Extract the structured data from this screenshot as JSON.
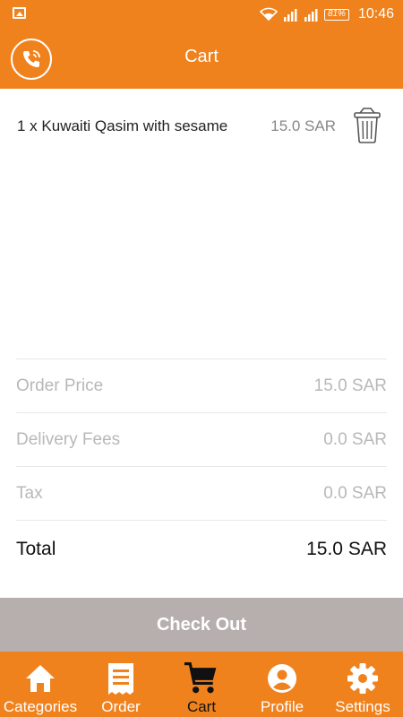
{
  "status_bar": {
    "battery": "81%",
    "time": "10:46"
  },
  "header": {
    "title": "Cart"
  },
  "cart_items": [
    {
      "description": "1 x Kuwaiti Qasim with sesame",
      "price": "15.0 SAR"
    }
  ],
  "summary": {
    "order_price_label": "Order Price",
    "order_price": "15.0 SAR",
    "delivery_label": "Delivery Fees",
    "delivery": "0.0 SAR",
    "tax_label": "Tax",
    "tax": "0.0 SAR",
    "total_label": "Total",
    "total": "15.0 SAR"
  },
  "checkout_label": "Check Out",
  "bottom_nav": [
    {
      "label": "Categories",
      "icon": "home-icon"
    },
    {
      "label": "Order",
      "icon": "receipt-icon"
    },
    {
      "label": "Cart",
      "icon": "cart-icon",
      "active": true
    },
    {
      "label": "Profile",
      "icon": "profile-icon"
    },
    {
      "label": "Settings",
      "icon": "gear-icon"
    }
  ],
  "colors": {
    "primary": "#f0821e",
    "checkout_bg": "#b7afae",
    "active_nav": "#111111"
  }
}
